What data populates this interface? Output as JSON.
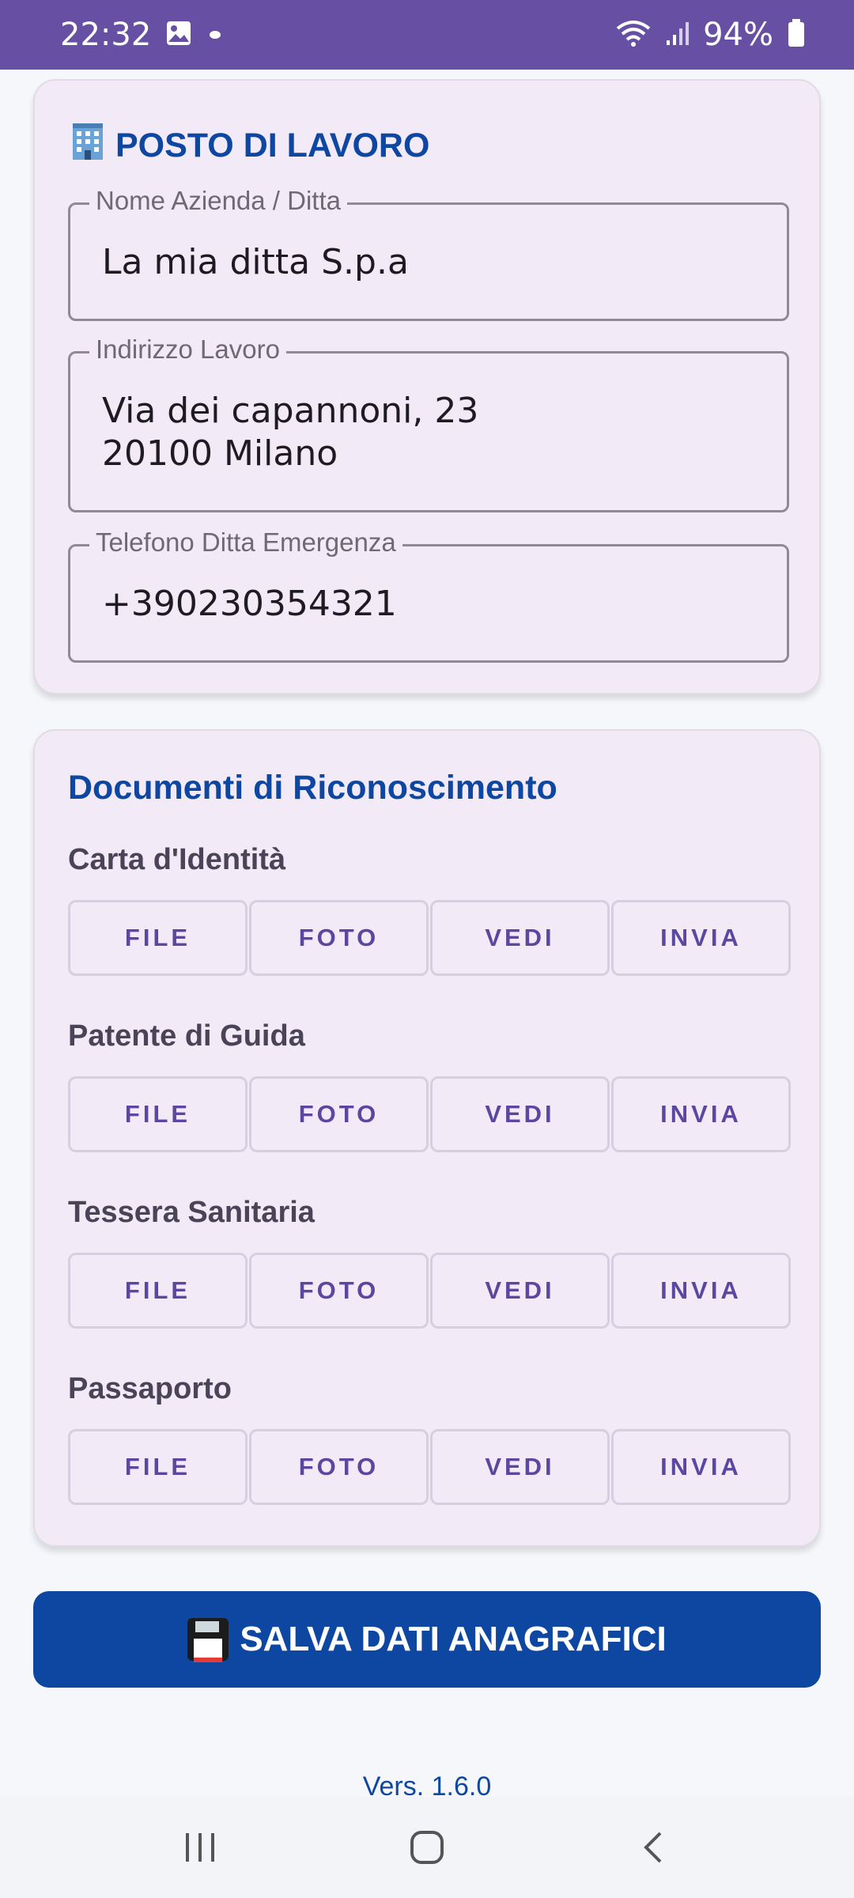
{
  "status_bar": {
    "time": "22:32",
    "battery": "94%"
  },
  "work_section": {
    "title": "POSTO DI LAVORO",
    "icon": "office-building-icon",
    "fields": [
      {
        "label": "Nome Azienda / Ditta",
        "value": "La mia ditta S.p.a"
      },
      {
        "label": "Indirizzo Lavoro",
        "value": "Via dei capannoni, 23\n20100 Milano"
      },
      {
        "label": "Telefono Ditta Emergenza",
        "value": "+390230354321"
      }
    ]
  },
  "docs_section": {
    "title": "Documenti di Riconoscimento",
    "documents": [
      {
        "label": "Carta d'Identità"
      },
      {
        "label": "Patente di Guida"
      },
      {
        "label": "Tessera Sanitaria"
      },
      {
        "label": "Passaporto"
      }
    ],
    "buttons": {
      "file": "FILE",
      "foto": "FOTO",
      "vedi": "VEDI",
      "invia": "INVIA"
    }
  },
  "save_button": {
    "label": "SALVA DATI ANAGRAFICI",
    "icon": "floppy-disk-icon"
  },
  "version": "Vers. 1.6.0",
  "colors": {
    "status_bar": "#6750a4",
    "primary": "#0d47a1",
    "card_bg": "#f3eaf7",
    "button_text": "#5b47a0"
  }
}
